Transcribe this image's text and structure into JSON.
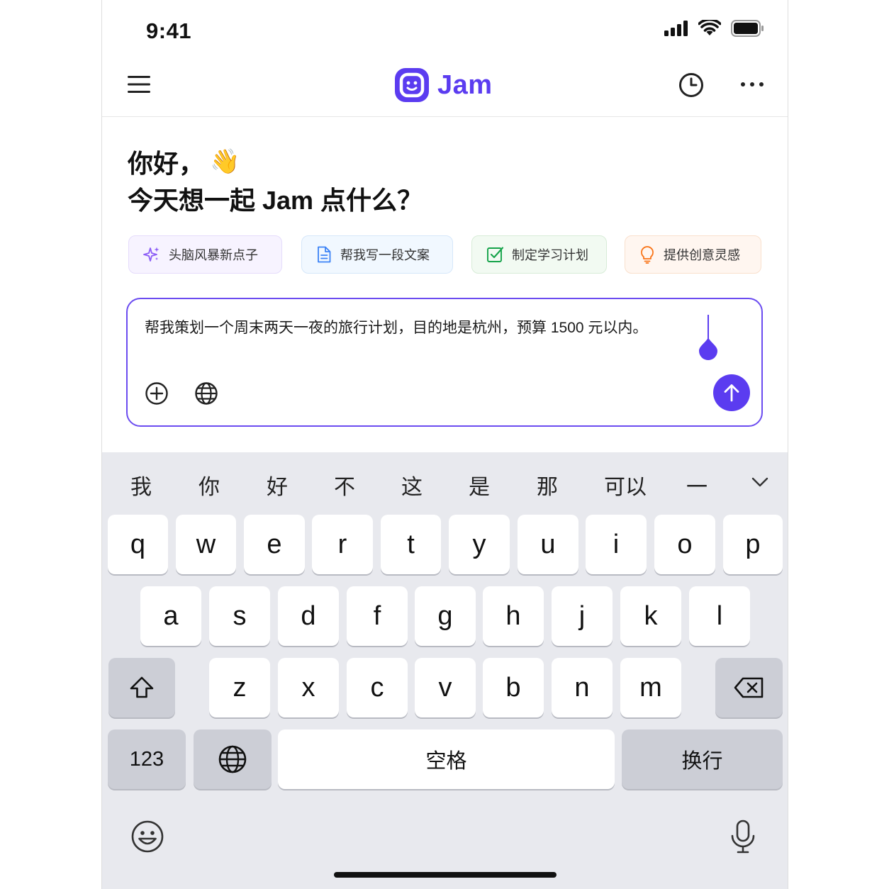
{
  "status": {
    "time": "9:41"
  },
  "app": {
    "name": "Jam",
    "brand_color": "#5b3cf0"
  },
  "greeting": {
    "line1": "你好，",
    "line2": "今天想一起 Jam 点什么？",
    "emoji": "👋"
  },
  "chips": [
    {
      "label": "头脑风暴新点子"
    },
    {
      "label": "帮我写一段文案"
    },
    {
      "label": "制定学习计划"
    },
    {
      "label": "提供创意灵感"
    }
  ],
  "input": {
    "value": "帮我策划一个周末两天一夜的旅行计划，目的地是杭州，预算 1500 元以内。"
  },
  "keyboard": {
    "candidates": [
      "我",
      "你",
      "好",
      "不",
      "这",
      "是",
      "那",
      "可以",
      "一"
    ],
    "row1": [
      "q",
      "w",
      "e",
      "r",
      "t",
      "y",
      "u",
      "i",
      "o",
      "p"
    ],
    "row2": [
      "a",
      "s",
      "d",
      "f",
      "g",
      "h",
      "j",
      "k",
      "l"
    ],
    "row3": [
      "z",
      "x",
      "c",
      "v",
      "b",
      "n",
      "m"
    ],
    "numbers_label": "123",
    "space_label": "空格",
    "return_label": "换行"
  }
}
